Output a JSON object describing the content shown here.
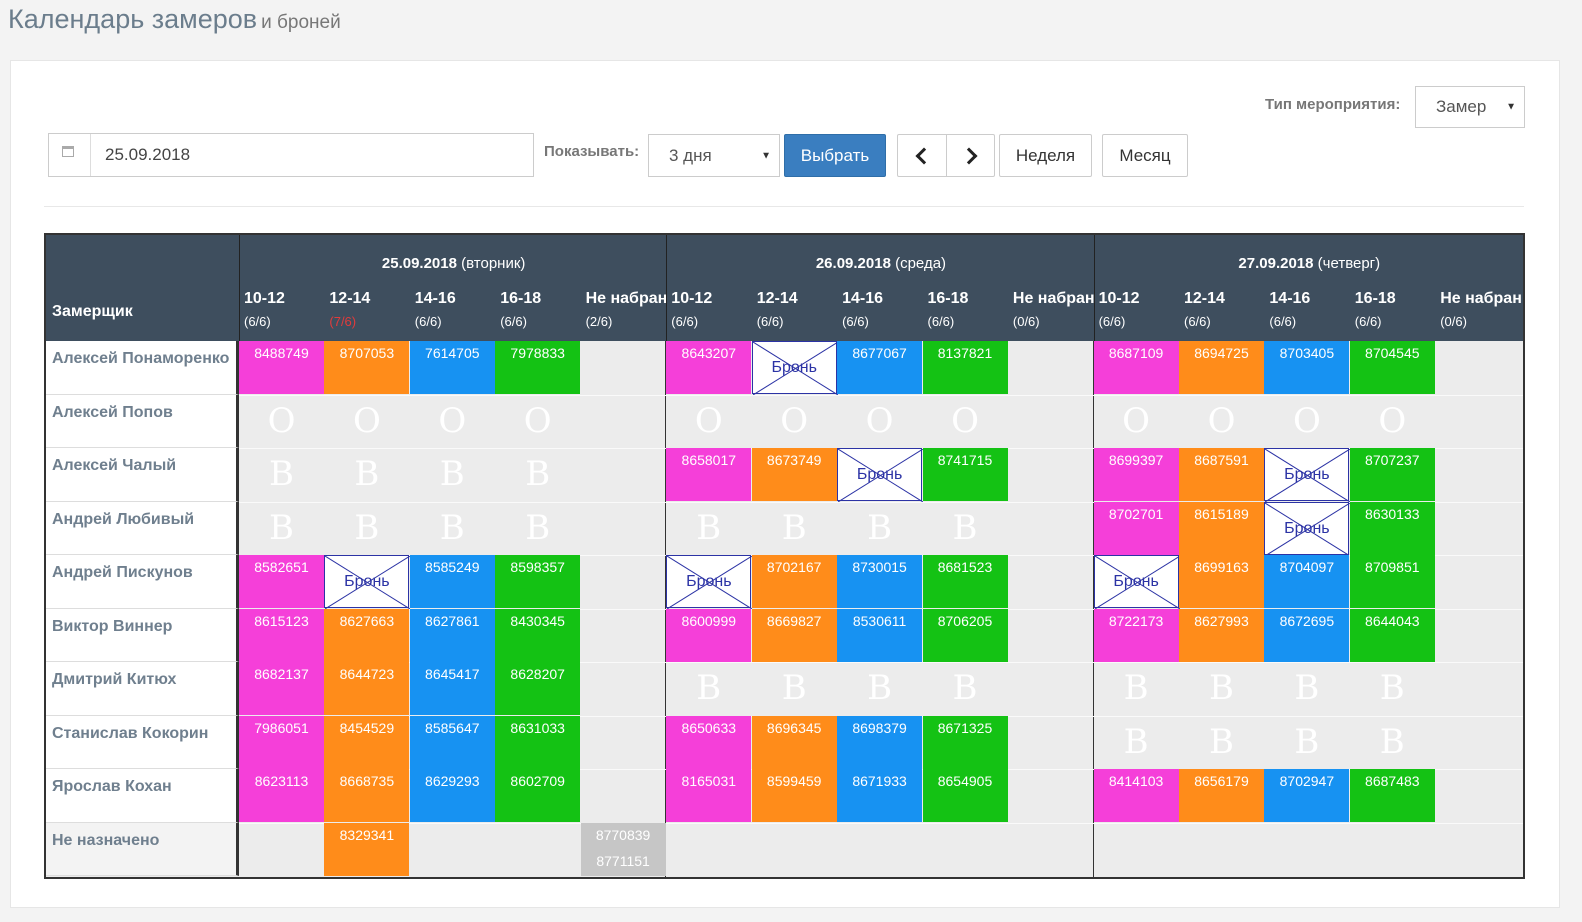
{
  "page": {
    "title": "Календарь замеров",
    "subtitle": "и броней"
  },
  "filters": {
    "type_label": "Тип мероприятия:",
    "type_value": "Замер",
    "date_value": "25.09.2018",
    "show_label": "Показывать:",
    "days_value": "3 дня",
    "select_button": "Выбрать",
    "week_button": "Неделя",
    "month_button": "Месяц"
  },
  "table": {
    "name_header": "Замерщик",
    "days": [
      {
        "date": "25.09.2018",
        "weekday": "(вторник)",
        "slots": [
          {
            "time": "10-12",
            "count": "(6/6)"
          },
          {
            "time": "12-14",
            "count": "(7/6)",
            "over": true
          },
          {
            "time": "14-16",
            "count": "(6/6)"
          },
          {
            "time": "16-18",
            "count": "(6/6)"
          },
          {
            "time": "Не набран",
            "count": "(2/6)"
          }
        ]
      },
      {
        "date": "26.09.2018",
        "weekday": "(среда)",
        "slots": [
          {
            "time": "10-12",
            "count": "(6/6)"
          },
          {
            "time": "12-14",
            "count": "(6/6)"
          },
          {
            "time": "14-16",
            "count": "(6/6)"
          },
          {
            "time": "16-18",
            "count": "(6/6)"
          },
          {
            "time": "Не набран",
            "count": "(0/6)"
          }
        ]
      },
      {
        "date": "27.09.2018",
        "weekday": "(четверг)",
        "slots": [
          {
            "time": "10-12",
            "count": "(6/6)"
          },
          {
            "time": "12-14",
            "count": "(6/6)"
          },
          {
            "time": "14-16",
            "count": "(6/6)"
          },
          {
            "time": "16-18",
            "count": "(6/6)"
          },
          {
            "time": "Не набран",
            "count": "(0/6)"
          }
        ]
      }
    ],
    "bron_label": "Бронь",
    "legend_colors": {
      "10-12": "#f53fd9",
      "12-14": "#ff8c1a",
      "14-16": "#1792f2",
      "16-18": "#14c214",
      "unassigned": "#c6c6c6"
    },
    "rows": [
      {
        "name": "Алексей Понаморенко",
        "days": [
          [
            "8488749",
            "8707053",
            "7614705",
            "7978833",
            ""
          ],
          [
            "8643207",
            "#BRON",
            "8677067",
            "8137821",
            ""
          ],
          [
            "8687109",
            "8694725",
            "8703405",
            "8704545",
            ""
          ]
        ]
      },
      {
        "name": "Алексей Попов",
        "days": [
          [
            "@О",
            "@О",
            "@О",
            "@О",
            ""
          ],
          [
            "@О",
            "@О",
            "@О",
            "@О",
            ""
          ],
          [
            "@О",
            "@О",
            "@О",
            "@О",
            ""
          ]
        ]
      },
      {
        "name": "Алексей Чалый",
        "days": [
          [
            "@В",
            "@В",
            "@В",
            "@В",
            ""
          ],
          [
            "8658017",
            "8673749",
            "#BRON",
            "8741715",
            ""
          ],
          [
            "8699397",
            "8687591",
            "#BRON",
            "8707237",
            ""
          ]
        ]
      },
      {
        "name": "Андрей Любивый",
        "days": [
          [
            "@В",
            "@В",
            "@В",
            "@В",
            ""
          ],
          [
            "@В",
            "@В",
            "@В",
            "@В",
            ""
          ],
          [
            "8702701",
            "8615189",
            "#BRON",
            "8630133",
            ""
          ]
        ]
      },
      {
        "name": "Андрей Пискунов",
        "days": [
          [
            "8582651",
            "#BRON",
            "8585249",
            "8598357",
            ""
          ],
          [
            "#BRON",
            "8702167",
            "8730015",
            "8681523",
            ""
          ],
          [
            "#BRON",
            "8699163",
            "8704097",
            "8709851",
            ""
          ]
        ]
      },
      {
        "name": "Виктор Виннер",
        "days": [
          [
            "8615123",
            "8627663",
            "8627861",
            "8430345",
            ""
          ],
          [
            "8600999",
            "8669827",
            "8530611",
            "8706205",
            ""
          ],
          [
            "8722173",
            "8627993",
            "8672695",
            "8644043",
            ""
          ]
        ]
      },
      {
        "name": "Дмитрий Китюх",
        "days": [
          [
            "8682137",
            "8644723",
            "8645417",
            "8628207",
            ""
          ],
          [
            "@В",
            "@В",
            "@В",
            "@В",
            ""
          ],
          [
            "@В",
            "@В",
            "@В",
            "@В",
            ""
          ]
        ]
      },
      {
        "name": "Станислав Кокорин",
        "days": [
          [
            "7986051",
            "8454529",
            "8585647",
            "8631033",
            ""
          ],
          [
            "8650633",
            "8696345",
            "8698379",
            "8671325",
            ""
          ],
          [
            "@В",
            "@В",
            "@В",
            "@В",
            ""
          ]
        ]
      },
      {
        "name": "Ярослав Кохан",
        "days": [
          [
            "8623113",
            "8668735",
            "8629293",
            "8602709",
            ""
          ],
          [
            "8165031",
            "8599459",
            "8671933",
            "8654905",
            ""
          ],
          [
            "8414103",
            "8656179",
            "8702947",
            "8687483",
            ""
          ]
        ]
      },
      {
        "name": "Не назначено",
        "days": [
          [
            "",
            "8329341",
            "",
            "",
            "8770839|8771151"
          ],
          [
            "",
            "",
            "",
            "",
            ""
          ],
          [
            "",
            "",
            "",
            "",
            ""
          ]
        ]
      }
    ]
  }
}
